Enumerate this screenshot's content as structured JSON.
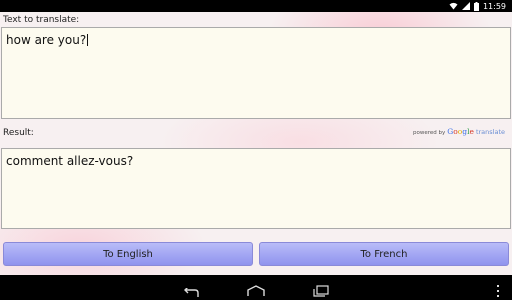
{
  "status_bar": {
    "time": "11:59",
    "icons": [
      "wifi-icon",
      "signal-icon",
      "battery-icon"
    ]
  },
  "input": {
    "label": "Text to translate:",
    "value": "how are you?"
  },
  "result": {
    "label": "Result:",
    "value": "comment allez-vous?"
  },
  "attribution": {
    "powered_by": "powered by",
    "brand": "Google",
    "service": "translate"
  },
  "buttons": {
    "to_english": "To English",
    "to_french": "To French"
  },
  "nav": {
    "icons": [
      "back-icon",
      "home-icon",
      "recent-apps-icon",
      "overflow-menu-icon"
    ]
  },
  "colors": {
    "button_fill": "#a3a6f3",
    "text_area_bg": "#fdfbef"
  }
}
